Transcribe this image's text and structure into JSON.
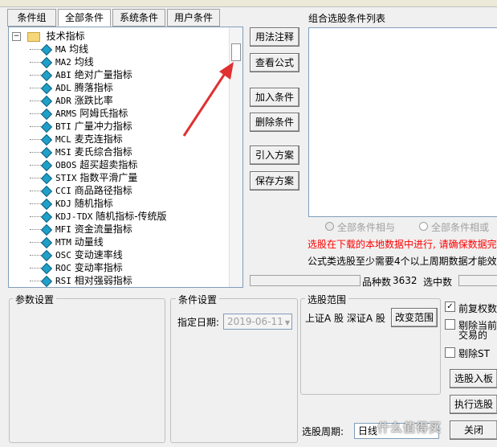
{
  "tabs": [
    "条件组",
    "全部条件",
    "系统条件",
    "用户条件"
  ],
  "tree": {
    "root_label": "技术指标",
    "items": [
      {
        "code": "MA",
        "name": "均线"
      },
      {
        "code": "MA2",
        "name": "均线"
      },
      {
        "code": "ABI",
        "name": "绝对广量指标"
      },
      {
        "code": "ADL",
        "name": "腾落指标"
      },
      {
        "code": "ADR",
        "name": "涨跌比率"
      },
      {
        "code": "ARMS",
        "name": "阿姆氏指标"
      },
      {
        "code": "BTI",
        "name": "广量冲力指标"
      },
      {
        "code": "MCL",
        "name": "麦克连指标"
      },
      {
        "code": "MSI",
        "name": "麦氏综合指标"
      },
      {
        "code": "OBOS",
        "name": "超买超卖指标"
      },
      {
        "code": "STIX",
        "name": "指数平滑广量"
      },
      {
        "code": "CCI",
        "name": "商品路径指标"
      },
      {
        "code": "KDJ",
        "name": "随机指标"
      },
      {
        "code": "KDJ-TDX",
        "name": "随机指标-传统版"
      },
      {
        "code": "MFI",
        "name": "资金流量指标"
      },
      {
        "code": "MTM",
        "name": "动量线"
      },
      {
        "code": "OSC",
        "name": "变动速率线"
      },
      {
        "code": "ROC",
        "name": "变动率指标"
      },
      {
        "code": "RSI",
        "name": "相对强弱指标"
      }
    ]
  },
  "buttons": {
    "usage": "用法注释",
    "view_formula": "查看公式",
    "add_condition": "加入条件",
    "delete_condition": "删除条件",
    "import_plan": "引入方案",
    "save_plan": "保存方案",
    "change_range": "改变范围",
    "select_to_board": "选股入板",
    "execute": "执行选股",
    "close": "关闭"
  },
  "list_title": "组合选股条件列表",
  "radio_and": "全部条件相与",
  "radio_or": "全部条件相或",
  "warning": "选股在下载的本地数据中进行, 请确保数据完",
  "note": "公式类选股至少需要4个以上周期数据才能效",
  "stock_count_label": "品种数",
  "stock_count_value": "3632",
  "selected_label": "选中数",
  "param_title": "参数设置",
  "cond_title": "条件设置",
  "date_label": "指定日期:",
  "date_value": "2019-06-11",
  "range_title": "选股范围",
  "range_value": "上证A 股  深证A 股",
  "check_restore": "前复权数",
  "check_exclude_today": "剔除当前",
  "check_exclude_today2": "交易的",
  "check_exclude_st": "剔除ST",
  "period_label": "选股周期:",
  "period_value": "日线",
  "watermark": "什么值得买",
  "colors": {
    "warning": "#ff0000",
    "arrow": "#e03030",
    "accent": "#20a0c8"
  }
}
